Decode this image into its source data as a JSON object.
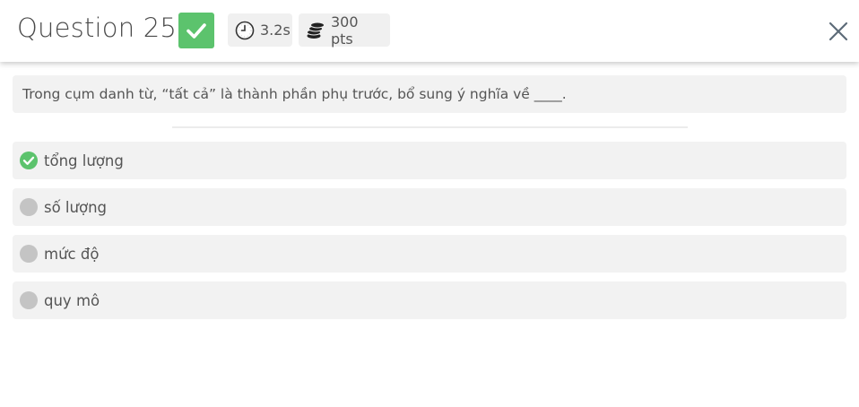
{
  "header": {
    "title": "Question 25",
    "status": "correct",
    "status_icon": "check-icon",
    "timer": {
      "icon": "clock-icon",
      "value": "3.2s"
    },
    "points": {
      "icon": "coins-icon",
      "value": "300 pts"
    },
    "close_icon": "close-icon"
  },
  "question": {
    "text": "Trong cụm danh từ, “tất cả” là thành phần phụ trước, bổ sung ý nghĩa về ____."
  },
  "options": [
    {
      "label": "tổng lượng",
      "state": "correct"
    },
    {
      "label": "số lượng",
      "state": "unselected"
    },
    {
      "label": "mức độ",
      "state": "unselected"
    },
    {
      "label": "quy mô",
      "state": "unselected"
    }
  ],
  "colors": {
    "correct_green": "#5cc36d",
    "option_bg": "#f2f2f2",
    "unselected_dot": "#c4c4c4",
    "close_icon": "#5d6b78"
  }
}
